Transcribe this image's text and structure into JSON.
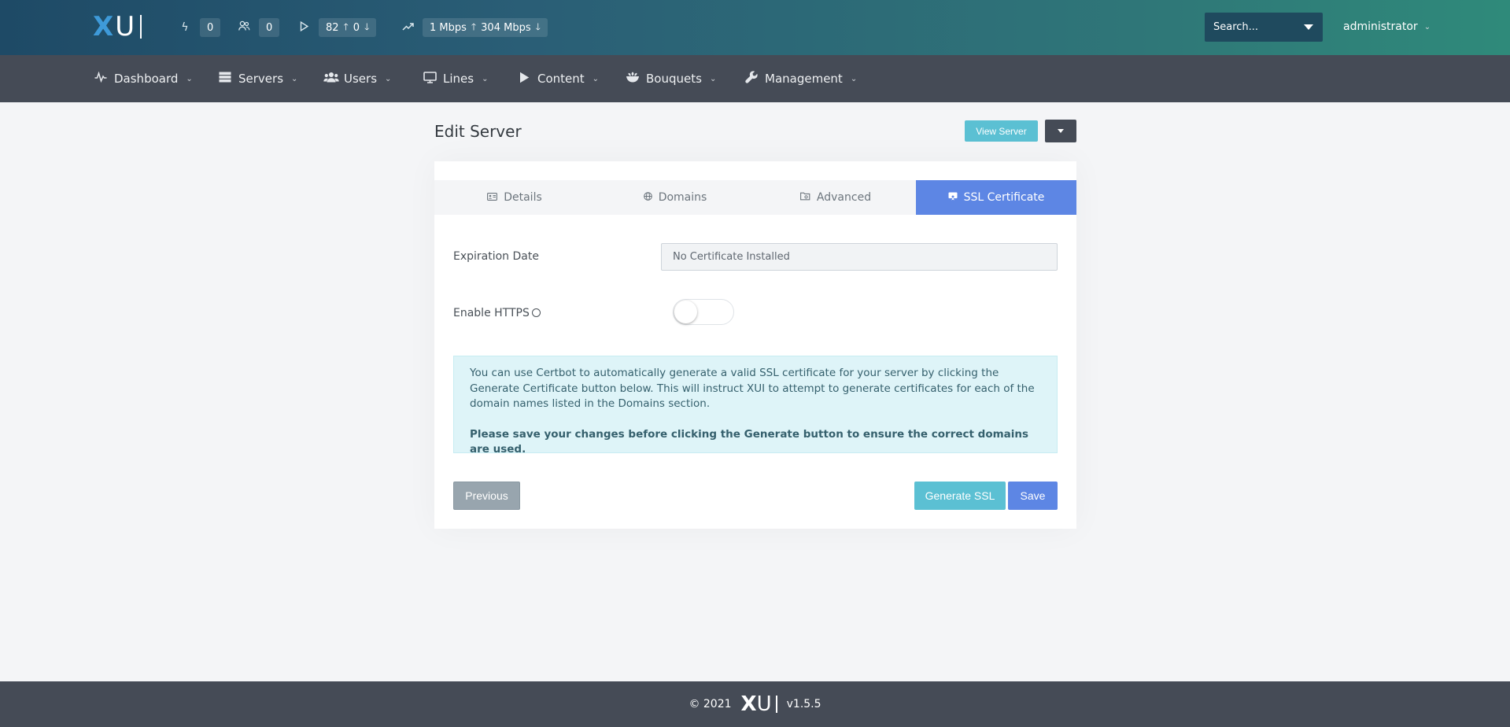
{
  "brand": {
    "logo_x": "X",
    "logo_rest": "U"
  },
  "topbar": {
    "stats": [
      {
        "icon": "lightning-icon",
        "value": "0"
      },
      {
        "icon": "users-icon",
        "value": "0"
      },
      {
        "icon": "play-icon",
        "value": "82",
        "value2": "0"
      },
      {
        "icon": "trend-icon",
        "value": "1 Mbps",
        "value2": "304 Mbps"
      }
    ],
    "search_placeholder": "Search...",
    "user": "administrator"
  },
  "nav": [
    {
      "label": "Dashboard",
      "icon": "pulse-icon"
    },
    {
      "label": "Servers",
      "icon": "server-icon"
    },
    {
      "label": "Users",
      "icon": "users-icon"
    },
    {
      "label": "Lines",
      "icon": "monitor-icon"
    },
    {
      "label": "Content",
      "icon": "play-icon"
    },
    {
      "label": "Bouquets",
      "icon": "flower-icon"
    },
    {
      "label": "Management",
      "icon": "wrench-icon"
    }
  ],
  "page": {
    "title": "Edit Server",
    "view_server_label": "View Server"
  },
  "tabs": [
    {
      "label": "Details",
      "active": false
    },
    {
      "label": "Domains",
      "active": false
    },
    {
      "label": "Advanced",
      "active": false
    },
    {
      "label": "SSL Certificate",
      "active": true
    }
  ],
  "form": {
    "expiration_label": "Expiration Date",
    "expiration_value": "No Certificate Installed",
    "https_label": "Enable HTTPS",
    "https_enabled": false
  },
  "alert": {
    "text": "You can use Certbot to automatically generate a valid SSL certificate for your server by clicking the Generate Certificate button below. This will instruct XUI to attempt to generate certificates for each of the domain names listed in the Domains section.",
    "strong": "Please save your changes before clicking the Generate button to ensure the correct domains are used."
  },
  "buttons": {
    "previous": "Previous",
    "generate": "Generate SSL",
    "save": "Save"
  },
  "footer": {
    "copyright": "© 2021",
    "logo_x": "X",
    "logo_rest": "U",
    "version": "v1.5.5"
  },
  "colors": {
    "accent": "#5d86e4",
    "info": "#5bc0d3",
    "nav_bg": "#454b56"
  }
}
